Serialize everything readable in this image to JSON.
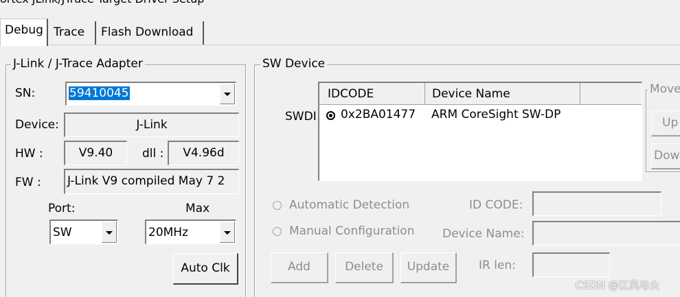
{
  "window_title": "ortex JLink/JTrace Target Driver Setup",
  "tabs": [
    "Debug",
    "Trace",
    "Flash Download"
  ],
  "adapter": {
    "legend": "J-Link / J-Trace Adapter",
    "sn_label": "SN:",
    "sn_value": "59410045",
    "device_label": "Device:",
    "device_value": "J-Link",
    "hw_label": "HW :",
    "hw_value": "V9.40",
    "dll_label": "dll :",
    "dll_value": "V4.96d",
    "fw_label": "FW :",
    "fw_value": "J-Link V9 compiled May  7 2",
    "port_label": "Port:",
    "port_value": "SW",
    "max_label": "Max",
    "max_value": "20MHz",
    "auto_clk_label": "Auto Clk"
  },
  "sw_device": {
    "legend": "SW Device",
    "row_label": "SWDI",
    "columns": [
      "IDCODE",
      "Device Name"
    ],
    "rows": [
      {
        "idcode": "0x2BA01477",
        "device_name": "ARM CoreSight SW-DP"
      }
    ],
    "move_label": "Move",
    "up_label": "Up",
    "down_label": "Dow",
    "auto_detection_label": "Automatic Detection",
    "manual_config_label": "Manual Configuration",
    "id_code_label": "ID CODE:",
    "device_name_label": "Device Name:",
    "ir_len_label": "IR len:",
    "add_label": "Add",
    "delete_label": "Delete",
    "update_label": "Update"
  },
  "watermark": "CSDN @江风与火",
  "colors": {
    "selection": "#0078d7",
    "disabled_text": "#8d8d8d",
    "background": "#f0f0f0"
  }
}
